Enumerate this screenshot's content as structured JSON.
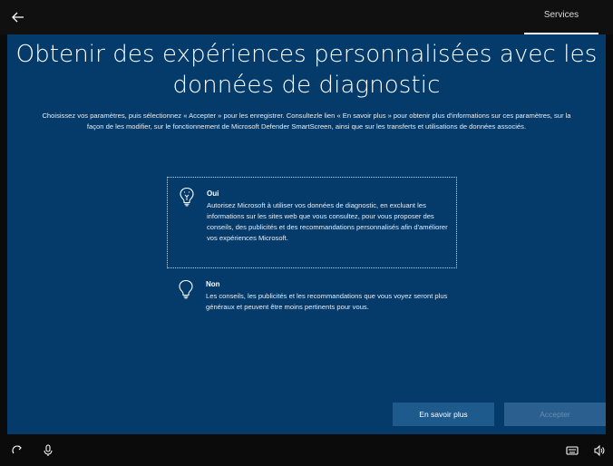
{
  "header": {
    "back_icon": "back-arrow-icon",
    "tab_label": "Services"
  },
  "main": {
    "title": "Obtenir des expériences personnalisées avec les données de diagnostic",
    "description": "Choisissez vos paramètres, puis sélectionnez « Accepter » pour les enregistrer. Consultezle lien « En savoir plus » pour obtenir plus d'informations sur ces paramètres, sur la façon de les modifier, sur le fonctionnement de Microsoft Defender SmartScreen, ainsi que sur les transferts et utilisations de données associés.",
    "options": [
      {
        "title": "Oui",
        "body": "Autorisez Microsoft à utiliser vos données de diagnostic, en excluant les informations sur les sites web que vous consultez, pour vous proposer des conseils, des publicités et des recommandations personnalisés afin d'améliorer vos expériences Microsoft.",
        "icon": "lightbulb-on-icon",
        "selected": true
      },
      {
        "title": "Non",
        "body": "Les conseils, les publicités et les recommandations que vous voyez seront plus généraux et peuvent être moins pertinents pour vous.",
        "icon": "lightbulb-off-icon",
        "selected": false
      }
    ]
  },
  "footer": {
    "learn_more_label": "En savoir plus",
    "accept_label": "Accepter"
  },
  "taskbar": {
    "icons": [
      "ease-of-access-icon",
      "microphone-icon",
      "keyboard-icon",
      "volume-icon"
    ]
  },
  "colors": {
    "background": "#053b6b",
    "button": "#1f5a8c",
    "button_disabled_text": "#6b8db0"
  }
}
